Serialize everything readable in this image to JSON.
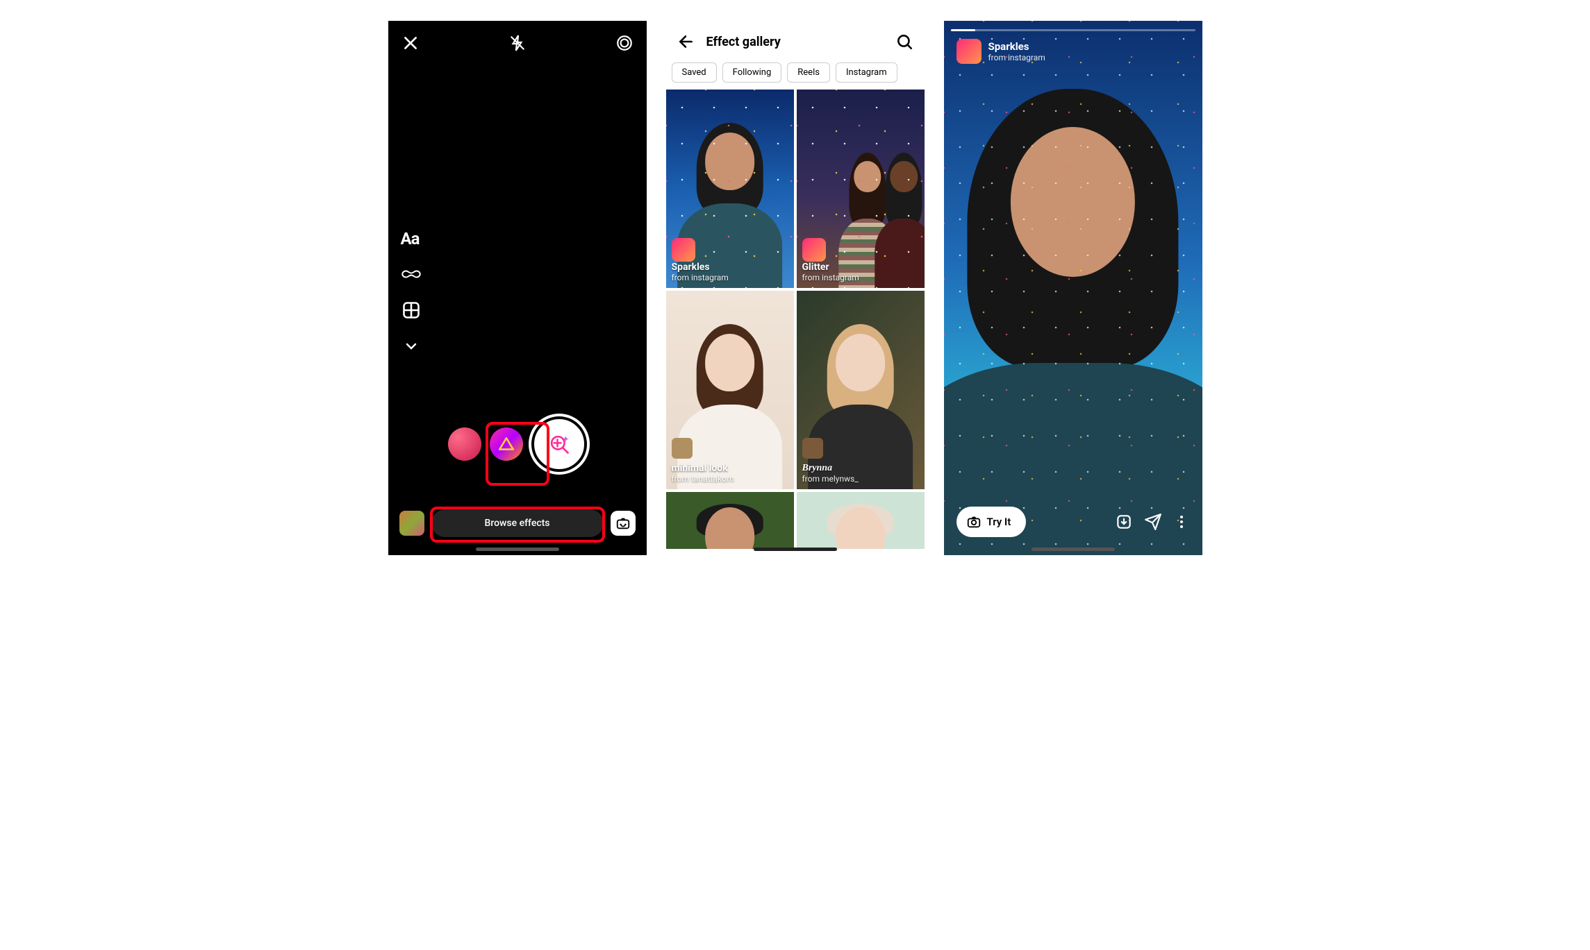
{
  "screen1": {
    "side_text_label": "Aa",
    "browse_effects_label": "Browse effects"
  },
  "screen2": {
    "title": "Effect gallery",
    "tabs": [
      "Saved",
      "Following",
      "Reels",
      "Instagram"
    ],
    "effects": [
      {
        "name": "Sparkles",
        "from": "from instagram"
      },
      {
        "name": "Glitter",
        "from": "from instagram"
      },
      {
        "name": "minimal look",
        "from": "from tanattakorn"
      },
      {
        "name": "Brynna",
        "from": "from melynws_"
      }
    ]
  },
  "screen3": {
    "effect_name": "Sparkles",
    "effect_from": "from instagram",
    "try_it_label": "Try It"
  }
}
